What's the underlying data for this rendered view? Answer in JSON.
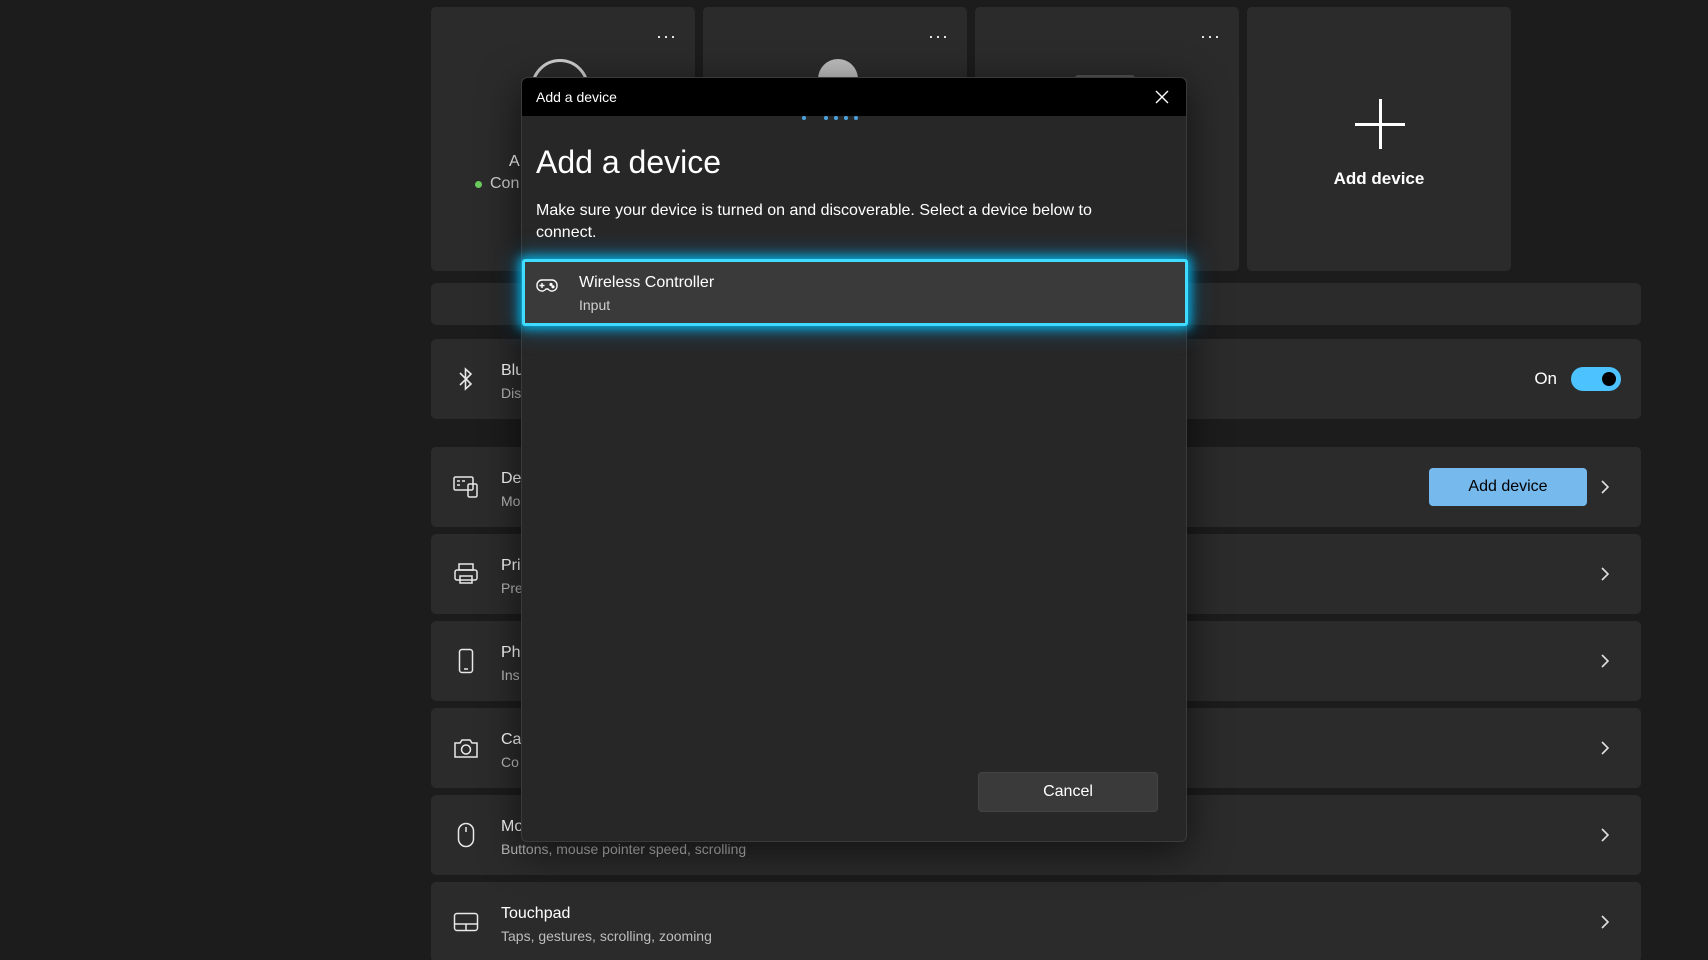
{
  "device_tiles": [
    {
      "name": "A",
      "status": "Con"
    },
    {
      "name": "",
      "status": ""
    },
    {
      "name": "",
      "status": ""
    }
  ],
  "add_tile": {
    "label": "Add device"
  },
  "tile_more_label": "···",
  "rows": {
    "bluetooth": {
      "title": "Blu",
      "sub": "Dis",
      "toggle_label": "On",
      "toggle_on": true
    },
    "devices": {
      "title": "De",
      "sub": "Mo",
      "button_label": "Add device"
    },
    "printers": {
      "title": "Pri",
      "sub": "Pre"
    },
    "phone": {
      "title": "Ph",
      "sub": "Ins"
    },
    "cameras": {
      "title": "Ca",
      "sub": "Co"
    },
    "mouse": {
      "title": "Mo",
      "sub": "Buttons, mouse pointer speed, scrolling"
    },
    "touchpad": {
      "title": "Touchpad",
      "sub": "Taps, gestures, scrolling, zooming"
    }
  },
  "modal": {
    "window_title": "Add a device",
    "heading": "Add a device",
    "description": "Make sure your device is turned on and discoverable. Select a device below to connect.",
    "devices": [
      {
        "name": "Wireless Controller",
        "type": "Input",
        "icon": "gamepad-icon"
      }
    ],
    "cancel_label": "Cancel"
  },
  "colors": {
    "accent": "#4cc2ff",
    "focus_ring": "#3fdcff",
    "button_accent": "#76b9ed",
    "status_connected": "#6ccb5f"
  }
}
